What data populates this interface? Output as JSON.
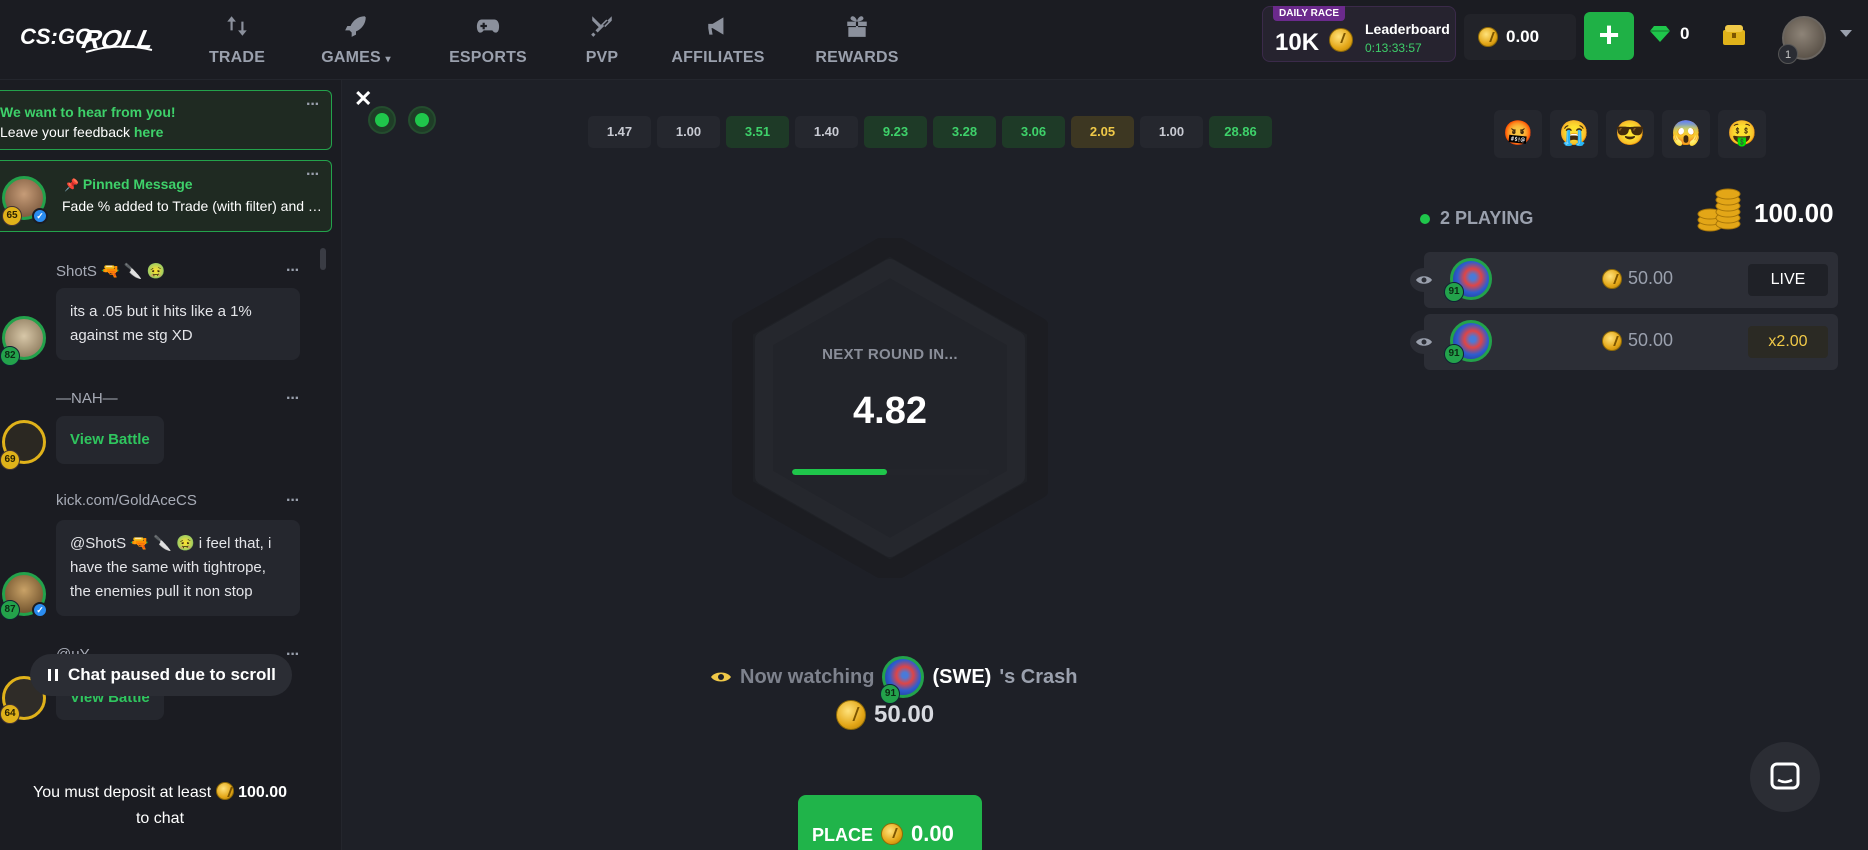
{
  "header": {
    "nav": [
      {
        "label": "TRADE",
        "icon": "trade-icon"
      },
      {
        "label": "GAMES",
        "icon": "rocket-icon"
      },
      {
        "label": "ESPORTS",
        "icon": "gamepad-icon"
      },
      {
        "label": "PVP",
        "icon": "swords-icon"
      },
      {
        "label": "AFFILIATES",
        "icon": "megaphone-icon"
      },
      {
        "label": "REWARDS",
        "icon": "gift-icon"
      }
    ],
    "race": {
      "tag": "DAILY RACE",
      "amount": "10K",
      "label": "Leaderboard",
      "timer": "0:13:33:57"
    },
    "balance": "0.00",
    "deposit_label": "+",
    "gems": "0",
    "user_level": "1"
  },
  "chat": {
    "feedback": {
      "line1": "We want to hear from you!",
      "line2_prefix": "Leave your feedback ",
      "link": "here"
    },
    "pinned": {
      "title": "Pinned Message",
      "text": "Fade % added to Trade (with filter) and Case Battles",
      "level": "65"
    },
    "messages": [
      {
        "name": "ShotS 🔫 🔪 🤢",
        "text": "its a .05 but it hits like a 1% against me stg XD",
        "level": "82"
      },
      {
        "name": "—NAH—",
        "text": "View Battle",
        "level": "69"
      },
      {
        "name": "kick.com/GoldAceCS",
        "text": "@ShotS 🔫 🔪 🤢 i feel that, i have the same with tightrope, the enemies pull it non stop",
        "level": "87"
      },
      {
        "name": "@uY...",
        "text": "View Battle",
        "level": "64"
      }
    ],
    "paused_label": "Chat paused due to scroll",
    "footer_prefix": "You must deposit at least",
    "footer_amount": "100.00",
    "footer_suffix": "to chat"
  },
  "game": {
    "history": [
      "1.47",
      "1.00",
      "3.51",
      "1.40",
      "9.23",
      "3.28",
      "3.06",
      "2.05",
      "1.00",
      "28.86"
    ],
    "history_colors": [
      "n",
      "n",
      "g",
      "n",
      "g",
      "g",
      "g",
      "y",
      "n",
      "g"
    ],
    "countdown_label": "NEXT ROUND IN...",
    "countdown_value": "4.82",
    "progress": 0.48,
    "watching": {
      "prefix": "Now watching",
      "player": "(SWE)",
      "suffix": "'s Crash",
      "level": "91",
      "amount": "50.00"
    },
    "place": {
      "label": "PLACE",
      "amount": "0.00"
    }
  },
  "players": {
    "emojis": [
      "🤬",
      "😭",
      "😎",
      "😱",
      "🤑"
    ],
    "count_label": "2 PLAYING",
    "pot": "100.00",
    "rows": [
      {
        "level": "91",
        "bet": "50.00",
        "status": "LIVE"
      },
      {
        "level": "91",
        "bet": "50.00",
        "status": "x2.00"
      }
    ]
  },
  "colors": {
    "accent_green": "#1fc64b",
    "gold": "#f0c948",
    "background": "#1e2027"
  }
}
